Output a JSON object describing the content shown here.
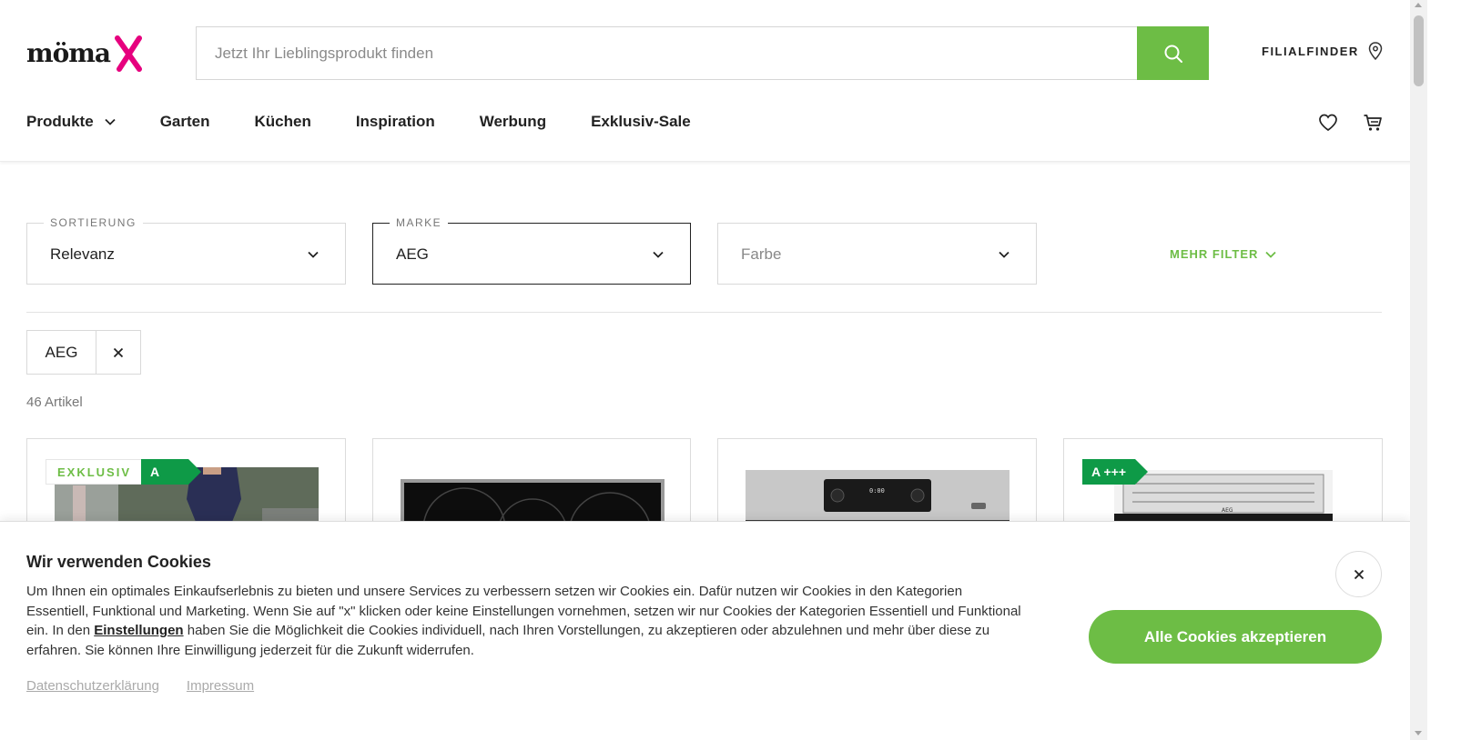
{
  "brand": {
    "logo_text": "möma",
    "accent_color": "#e6007e",
    "primary_color": "#6dbd45"
  },
  "search": {
    "placeholder": "Jetzt Ihr Lieblingsprodukt finden"
  },
  "header": {
    "filialfinder_label": "FILIALFINDER"
  },
  "nav": {
    "items": [
      "Produkte",
      "Garten",
      "Küchen",
      "Inspiration",
      "Werbung",
      "Exklusiv-Sale"
    ]
  },
  "filters": {
    "sort": {
      "legend": "SORTIERUNG",
      "value": "Relevanz"
    },
    "brand": {
      "legend": "MARKE",
      "value": "AEG"
    },
    "color": {
      "placeholder": "Farbe"
    },
    "more_label": "MEHR FILTER"
  },
  "active_chip": {
    "label": "AEG"
  },
  "result_count": "46 Artikel",
  "products": [
    {
      "badge_exklusiv": "EXKLUSIV",
      "energy": "A"
    },
    {
      "energy": ""
    },
    {
      "display_time": "0:00"
    },
    {
      "energy": "A +++"
    }
  ],
  "cookie": {
    "title": "Wir verwenden Cookies",
    "text_before": "Um Ihnen ein optimales Einkaufserlebnis zu bieten und unsere Services zu verbessern setzen wir Cookies ein. Dafür nutzen wir Cookies in den Kategorien Essentiell, Funktional und Marketing. Wenn Sie auf \"x\" klicken oder keine Einstellungen vornehmen, setzen wir nur Cookies der Kategorien Essentiell und Funktional ein. In den ",
    "settings_link": "Einstellungen",
    "text_after": " haben Sie die Möglichkeit die Cookies individuell, nach Ihren Vorstellungen, zu akzeptieren oder abzulehnen und mehr über diese zu erfahren. Sie können Ihre Einwilligung jederzeit für die Zukunft widerrufen.",
    "privacy_link": "Datenschutzerklärung",
    "imprint_link": "Impressum",
    "accept_button": "Alle Cookies akzeptieren"
  }
}
